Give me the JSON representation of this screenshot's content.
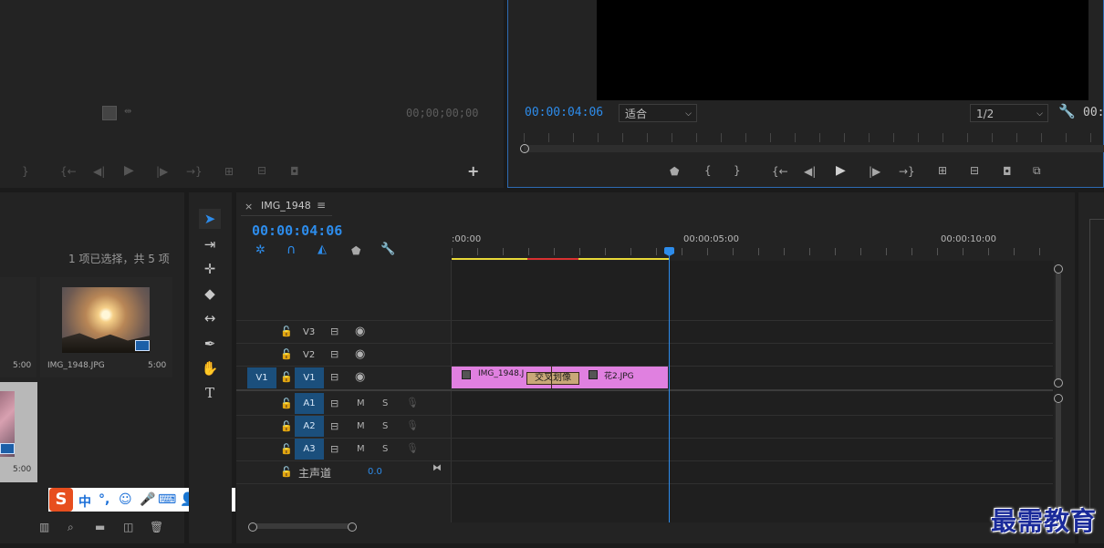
{
  "source_monitor": {
    "timecode": "00;00;00;00"
  },
  "program_monitor": {
    "timecode": "00:00:04:06",
    "fit_dropdown": "适合",
    "quality_dropdown": "1/2",
    "timecode_right": "00:0"
  },
  "project_panel": {
    "selection_info": "1 项已选择，共 5 项",
    "items": [
      {
        "name": "IMG_1948.JPG",
        "duration": "5:00"
      },
      {
        "name": "",
        "duration": "5:00"
      },
      {
        "name": "",
        "duration": "5:00"
      }
    ]
  },
  "timeline": {
    "tab_title": "IMG_1948",
    "close_label": "×",
    "menu_label": "≡",
    "timecode": "00:00:04:06",
    "ruler_labels": [
      ":00:00",
      "00:00:05:00",
      "00:00:10:00"
    ],
    "tracks": {
      "video": [
        {
          "name": "V3"
        },
        {
          "name": "V2"
        },
        {
          "name": "V1",
          "source_patch": "V1"
        }
      ],
      "audio": [
        {
          "name": "A1",
          "m": "M",
          "s": "S"
        },
        {
          "name": "A2",
          "m": "M",
          "s": "S"
        },
        {
          "name": "A3",
          "m": "M",
          "s": "S"
        }
      ],
      "master": {
        "label": "主声道",
        "value": "0.0"
      }
    },
    "clips": [
      {
        "name": "IMG_1948.J"
      },
      {
        "name": "花2.JPG"
      }
    ],
    "transition_label": "交叉划像"
  },
  "watermark": "最需教育",
  "ime_toolbar": {
    "logo": "S",
    "mode": "中",
    "punct": "°,"
  },
  "colors": {
    "accent_blue": "#2d8ceb",
    "clip_pink": "#e080e0",
    "transition_tan": "#c9a878",
    "render_yellow": "#e8d838",
    "render_red": "#d83030",
    "playhead": "#2d8ceb"
  }
}
